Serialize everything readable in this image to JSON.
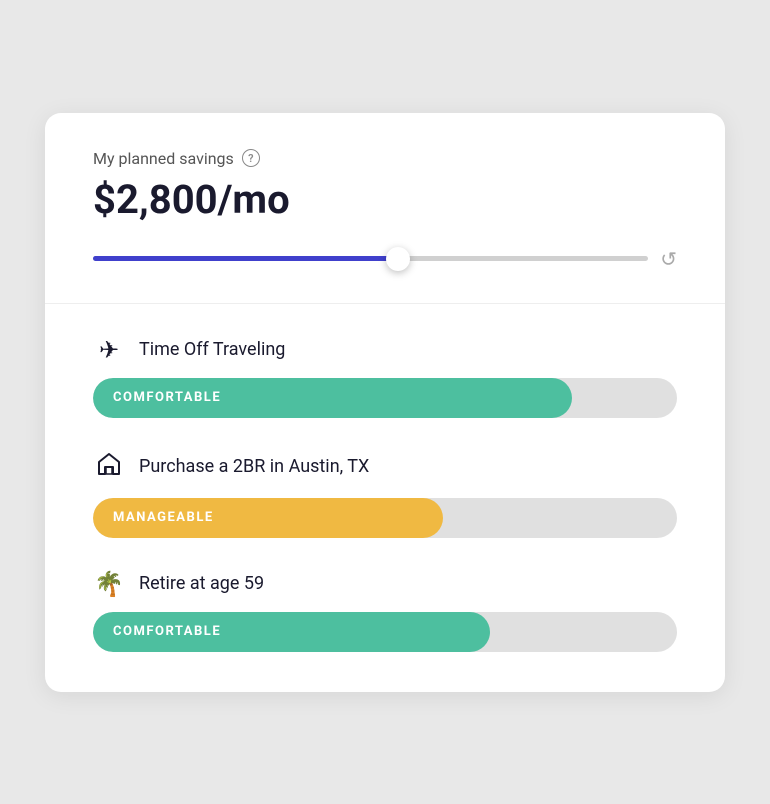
{
  "savings": {
    "label": "My planned savings",
    "help_icon": "?",
    "amount": "$2,800/mo",
    "slider_fill_percent": 55,
    "reset_icon": "↺"
  },
  "goals": [
    {
      "id": "travel",
      "icon": "✈",
      "title": "Time Off Traveling",
      "status_label": "COMFORTABLE",
      "status_type": "comfortable",
      "fill_percent": 82
    },
    {
      "id": "home",
      "icon": "⌂",
      "title": "Purchase a 2BR in Austin, TX",
      "status_label": "MANAGEABLE",
      "status_type": "manageable",
      "fill_percent": 60
    },
    {
      "id": "retire",
      "icon": "🌴",
      "title": "Retire at age 59",
      "status_label": "COMFORTABLE",
      "status_type": "comfortable-2",
      "fill_percent": 68
    }
  ]
}
